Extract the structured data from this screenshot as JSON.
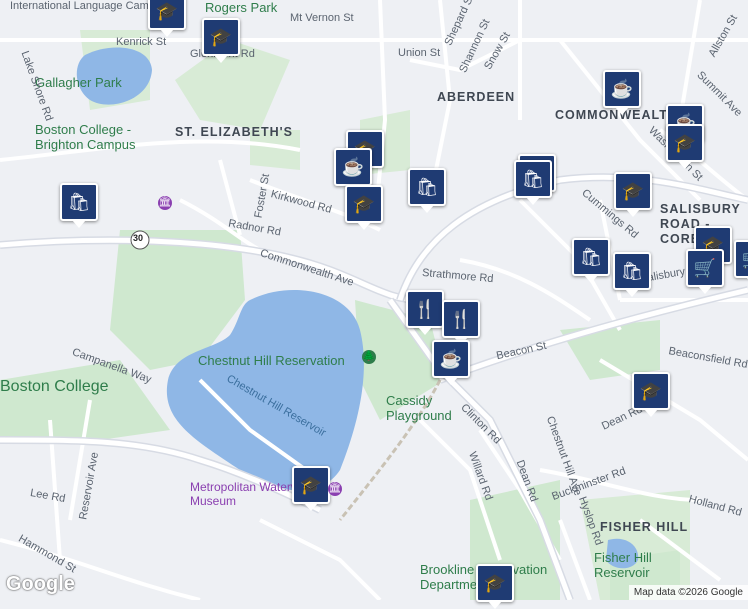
{
  "labels": {
    "neighborhoods": [
      "ABERDEEN",
      "ST. ELIZABETH'S",
      "COMMONWEALTH",
      "SALISBURY",
      "ROAD -",
      "CORE",
      "FISHER HILL"
    ],
    "places": [
      "Gallagher Park",
      "Boston College - Brighton Campus",
      "Rogers Park",
      "Chestnut Hill Reservation",
      "Cassidy Playground",
      "Fisher Hill Reservoir",
      "Metropolitan Waterworks Museum",
      "Boston College",
      "Brookline Reservation Department",
      "International Language Campus"
    ],
    "water": [
      "Chestnut Hill Reservoir"
    ],
    "roads": [
      "Commonwealth Ave",
      "Beacon St",
      "Chestnut Hill Ave",
      "Foster St",
      "Kirkwood Rd",
      "Radnor Rd",
      "Strathmore Rd",
      "Kenrick St",
      "Glenmont Rd",
      "Lake Shore Rd",
      "Mt Vernon St",
      "Union St",
      "Snow St",
      "Shannon St",
      "Shepard St",
      "Cummings Rd",
      "Campanella Way",
      "Reservoir Ave",
      "Lee Rd",
      "Hammond St",
      "Clinton Rd",
      "Dean Rd",
      "Willard Rd",
      "Buckminster Rd",
      "Hyslop Rd",
      "Holland Rd",
      "Beaconsfield Rd",
      "Summit Ave",
      "Allston St",
      "Washington St",
      "Salisbury Rd",
      "Dean Rd 2",
      "Chestnut Hill Ave"
    ],
    "route_shield": "30"
  },
  "pins": {
    "school": "school-icon",
    "cafe": "cafe-icon",
    "shopping": "shopping-bag-icon",
    "restaurant": "restaurant-icon",
    "grocery": "shopping-cart-icon",
    "museum": "museum-icon",
    "bag_label": "🛅",
    "cart_label": "🛒"
  },
  "colors": {
    "pin": "#1f3b73",
    "park": "#cfe8cf",
    "water": "#8fb7e6",
    "road": "#ffffff",
    "major_road": "#d7dbe4",
    "background": "#eef0f4"
  },
  "footer": {
    "logo": "Google",
    "attribution": "Map data ©2026 Google"
  }
}
